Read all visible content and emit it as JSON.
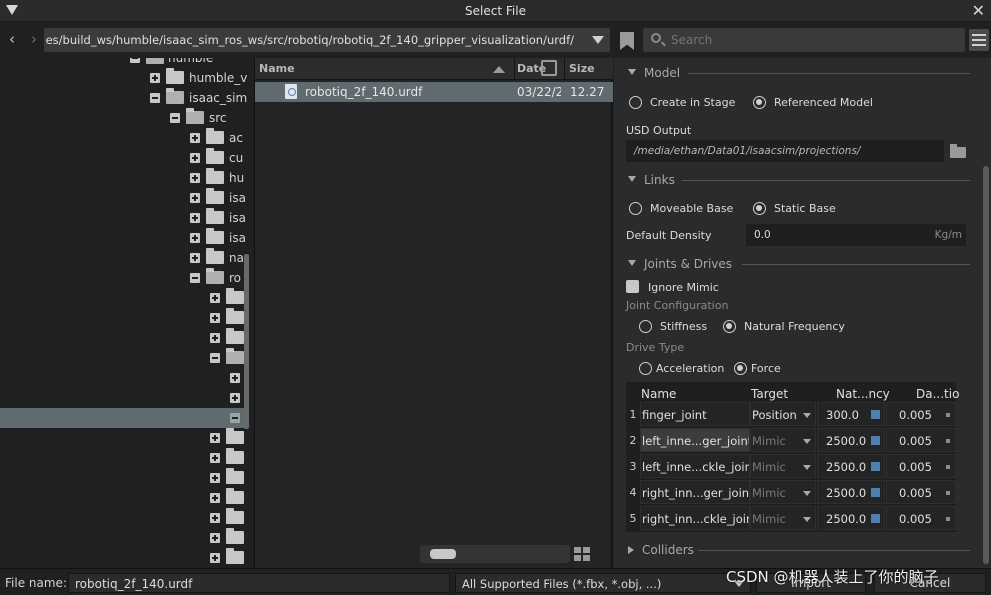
{
  "window": {
    "title": "Select File"
  },
  "pathbar": {
    "back_glyph": "‹",
    "forward_glyph": "›",
    "path": "es/build_ws/humble/isaac_sim_ros_ws/src/robotiq/robotiq_2f_140_gripper_visualization/urdf/",
    "search_placeholder": "Search"
  },
  "tree": {
    "items": [
      {
        "label": "humble"
      },
      {
        "label": "humble_v"
      },
      {
        "label": "isaac_sim"
      },
      {
        "label": "src"
      },
      {
        "label": "ac"
      },
      {
        "label": "cu"
      },
      {
        "label": "hu"
      },
      {
        "label": "isa"
      },
      {
        "label": "isa"
      },
      {
        "label": "isa"
      },
      {
        "label": "na"
      },
      {
        "label": "ro"
      }
    ]
  },
  "filelist": {
    "columns": {
      "name": "Name",
      "date": "Date",
      "size": "Size"
    },
    "rows": [
      {
        "name": "robotiq_2f_140.urdf",
        "date": "03/22/20",
        "size": "12.27"
      }
    ]
  },
  "properties": {
    "model": {
      "header": "Model",
      "option_create": "Create in Stage",
      "option_referenced": "Referenced Model",
      "selected": "Referenced Model",
      "usd_output_label": "USD Output",
      "usd_output_value": "/media/ethan/Data01/isaacsim/projections/"
    },
    "links": {
      "header": "Links",
      "option_moveable": "Moveable Base",
      "option_static": "Static Base",
      "selected": "Static Base",
      "density_label": "Default Density",
      "density_value": "0.0",
      "density_unit": "Kg/m"
    },
    "joints": {
      "header": "Joints & Drives",
      "ignore_mimic_label": "Ignore Mimic",
      "joint_config_label": "Joint Configuration",
      "option_stiffness": "Stiffness",
      "option_natural": "Natural Frequency",
      "joint_config_selected": "Natural Frequency",
      "drive_type_label": "Drive Type",
      "option_acceleration": "Acceleration",
      "option_force": "Force",
      "drive_type_selected": "Force",
      "table": {
        "columns": [
          "Name",
          "Target",
          "Nat...ncy",
          "Da...tio"
        ],
        "rows": [
          {
            "index": "1",
            "name": "finger_joint",
            "target": "Position",
            "natural": "300.0",
            "damping": "0.005"
          },
          {
            "index": "2",
            "name": "left_inne...ger_joint",
            "target": "Mimic",
            "natural": "2500.0",
            "damping": "0.005"
          },
          {
            "index": "3",
            "name": "left_inne...ckle_joint",
            "target": "Mimic",
            "natural": "2500.0",
            "damping": "0.005"
          },
          {
            "index": "4",
            "name": "right_inn...ger_joint",
            "target": "Mimic",
            "natural": "2500.0",
            "damping": "0.005"
          },
          {
            "index": "5",
            "name": "right_inn...ckle_joint",
            "target": "Mimic",
            "natural": "2500.0",
            "damping": "0.005"
          }
        ]
      }
    },
    "colliders": {
      "header": "Colliders"
    }
  },
  "bottombar": {
    "file_name_label": "File name:",
    "file_name_value": "robotiq_2f_140.urdf",
    "filter_value": "All Supported Files (*.fbx, *.obj, ...)",
    "import_label": "Import",
    "cancel_label": "Cancel"
  },
  "watermark": "CSDN @机器人装上了你的脑子",
  "colors": {
    "selection": "#5f6b6f",
    "accent_blue": "#4f7fb0",
    "panel": "#2a2b2c"
  }
}
